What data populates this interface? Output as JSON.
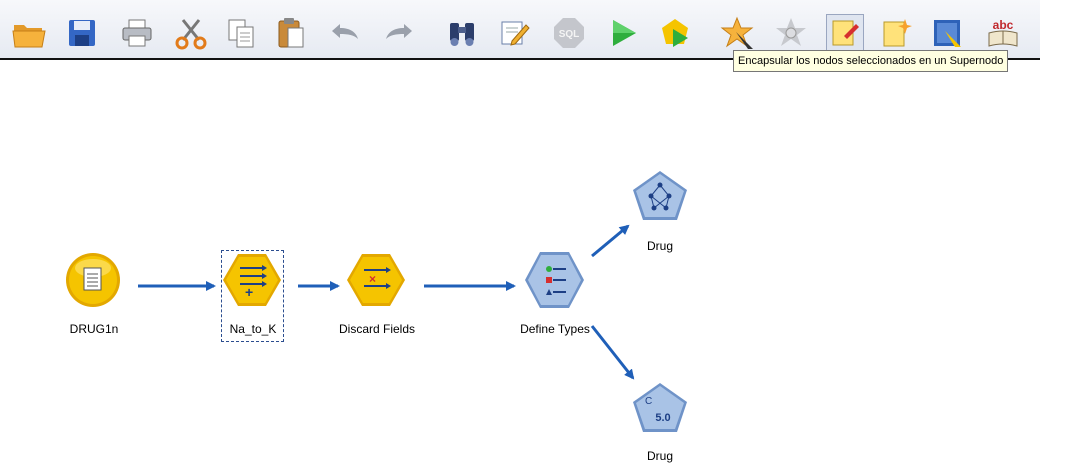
{
  "toolbar": {
    "buttons": [
      {
        "name": "open-icon"
      },
      {
        "name": "save-icon"
      },
      {
        "name": "print-icon"
      },
      {
        "name": "cut-icon"
      },
      {
        "name": "copy-icon"
      },
      {
        "name": "paste-icon"
      },
      {
        "name": "undo-icon"
      },
      {
        "name": "redo-icon"
      },
      {
        "name": "find-icon"
      },
      {
        "name": "edit-icon"
      },
      {
        "name": "sql-icon",
        "label": "SQL"
      },
      {
        "name": "run-icon"
      },
      {
        "name": "run-selection-icon"
      },
      {
        "name": "supernode-create-icon"
      },
      {
        "name": "supernode-zoom-icon"
      },
      {
        "name": "annotation-icon"
      },
      {
        "name": "new-comment-icon"
      },
      {
        "name": "zoom-icon"
      },
      {
        "name": "spell-check-icon",
        "label": "abc"
      }
    ]
  },
  "tooltip": {
    "text": "Encapsular los nodos seleccionados en un Supernodo"
  },
  "stream": {
    "nodes": [
      {
        "id": "drug1n",
        "label": "DRUG1n",
        "kind": "source-file",
        "color": "#f5c400"
      },
      {
        "id": "na_to_k",
        "label": "Na_to_K",
        "kind": "derive",
        "color": "#f5c400",
        "selected": true
      },
      {
        "id": "discard",
        "label": "Discard Fields",
        "kind": "filter",
        "color": "#f5c400"
      },
      {
        "id": "types",
        "label": "Define Types",
        "kind": "type",
        "color": "#8fb0dc"
      },
      {
        "id": "drug_nn",
        "label": "Drug",
        "kind": "neural-net-model",
        "color": "#8fb0dc"
      },
      {
        "id": "drug_c50",
        "label": "Drug",
        "kind": "c50-model",
        "color": "#8fb0dc",
        "badge": "5.0"
      }
    ]
  },
  "colors": {
    "link": "#1f5fb8",
    "source": "#f5c400",
    "model": "#8fb0dc",
    "tooltip_bg": "#ffffe1"
  }
}
